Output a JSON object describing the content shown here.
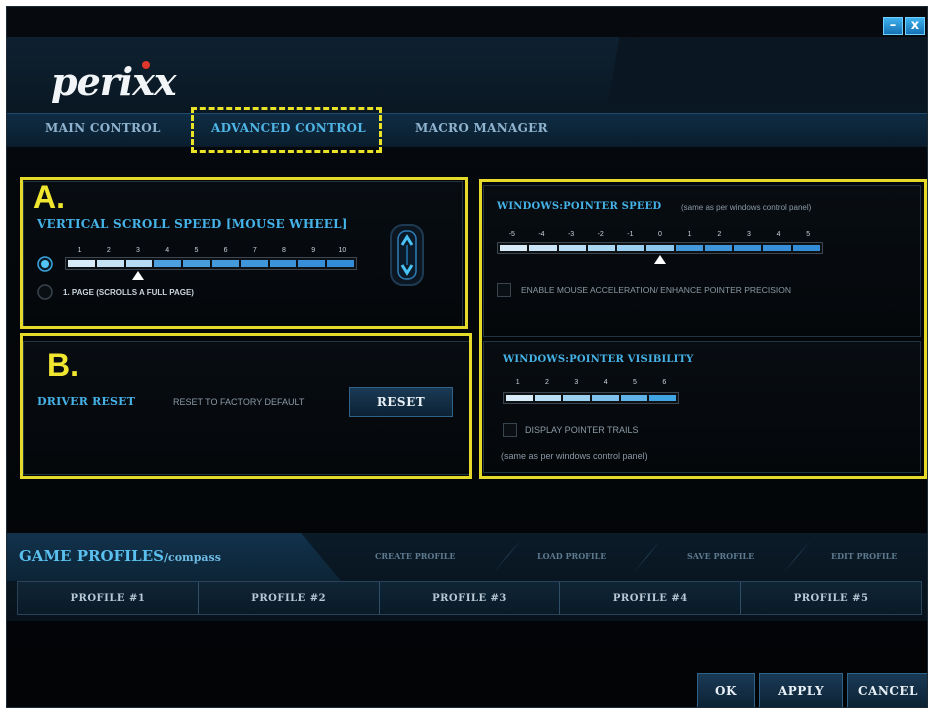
{
  "window": {
    "brand": "perixx",
    "minimize_glyph": "–",
    "close_glyph": "x"
  },
  "tabs": [
    {
      "label": "MAIN CONTROL"
    },
    {
      "label": "ADVANCED CONTROL",
      "selected": true
    },
    {
      "label": "MACRO MANAGER"
    }
  ],
  "annotations": {
    "a": "A.",
    "b": "B."
  },
  "scroll": {
    "title": "VERTICAL SCROLL SPEED [MOUSE WHEEL]",
    "ticks": [
      "1",
      "2",
      "3",
      "4",
      "5",
      "6",
      "7",
      "8",
      "9",
      "10"
    ],
    "value": 3,
    "page_option": "1. PAGE (SCROLLS A FULL PAGE)"
  },
  "pointer_speed": {
    "title": "WINDOWS:POINTER SPEED",
    "note": "(same as per windows control panel)",
    "ticks": [
      "-5",
      "-4",
      "-3",
      "-2",
      "-1",
      "0",
      "1",
      "2",
      "3",
      "4",
      "5"
    ],
    "value": 0,
    "accel_label": "ENABLE MOUSE ACCELERATION/ ENHANCE POINTER PRECISION"
  },
  "driver_reset": {
    "title": "DRIVER RESET",
    "desc": "RESET TO FACTORY DEFAULT",
    "button": "RESET"
  },
  "pointer_visibility": {
    "title": "WINDOWS:POINTER VISIBILITY",
    "ticks": [
      "1",
      "2",
      "3",
      "4",
      "5",
      "6"
    ],
    "value": 6,
    "trails_label": "DISPLAY POINTER TRAILS",
    "note": "(same as per windows control panel)"
  },
  "profiles": {
    "title": "GAME PROFILES",
    "subtitle": "/compass",
    "actions": [
      "CREATE PROFILE",
      "LOAD PROFILE",
      "SAVE PROFILE",
      "EDIT PROFILE"
    ],
    "items": [
      "PROFILE #1",
      "PROFILE #2",
      "PROFILE #3",
      "PROFILE #4",
      "PROFILE #5"
    ]
  },
  "footer": {
    "ok": "OK",
    "apply": "APPLY",
    "cancel": "CANCEL"
  },
  "colors": {
    "accent": "#45b3e8",
    "annotation_yellow": "#e5da2a",
    "slider_fill": "#cfe8f7",
    "slider_fill_dark": "#3aa6e0"
  }
}
